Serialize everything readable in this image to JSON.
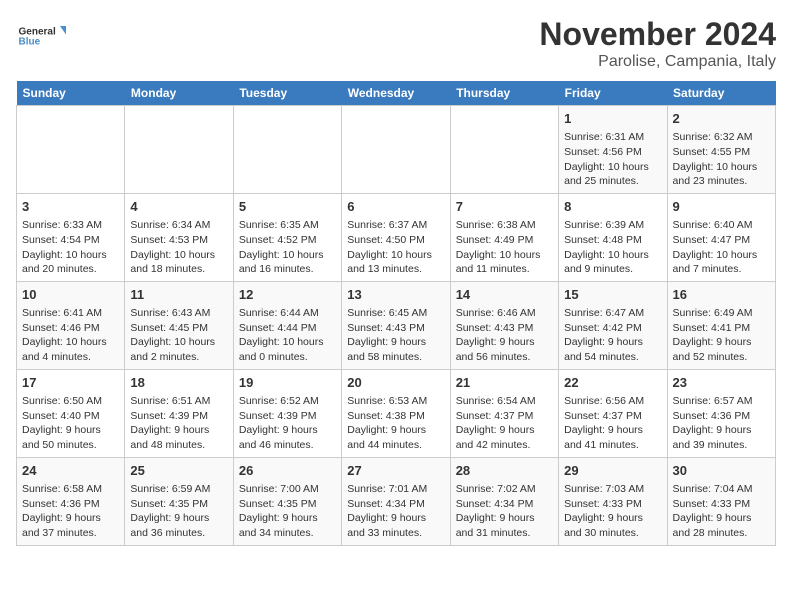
{
  "logo": {
    "line1": "General",
    "line2": "Blue"
  },
  "title": "November 2024",
  "location": "Parolise, Campania, Italy",
  "weekdays": [
    "Sunday",
    "Monday",
    "Tuesday",
    "Wednesday",
    "Thursday",
    "Friday",
    "Saturday"
  ],
  "weeks": [
    [
      {
        "day": "",
        "info": ""
      },
      {
        "day": "",
        "info": ""
      },
      {
        "day": "",
        "info": ""
      },
      {
        "day": "",
        "info": ""
      },
      {
        "day": "",
        "info": ""
      },
      {
        "day": "1",
        "info": "Sunrise: 6:31 AM\nSunset: 4:56 PM\nDaylight: 10 hours and 25 minutes."
      },
      {
        "day": "2",
        "info": "Sunrise: 6:32 AM\nSunset: 4:55 PM\nDaylight: 10 hours and 23 minutes."
      }
    ],
    [
      {
        "day": "3",
        "info": "Sunrise: 6:33 AM\nSunset: 4:54 PM\nDaylight: 10 hours and 20 minutes."
      },
      {
        "day": "4",
        "info": "Sunrise: 6:34 AM\nSunset: 4:53 PM\nDaylight: 10 hours and 18 minutes."
      },
      {
        "day": "5",
        "info": "Sunrise: 6:35 AM\nSunset: 4:52 PM\nDaylight: 10 hours and 16 minutes."
      },
      {
        "day": "6",
        "info": "Sunrise: 6:37 AM\nSunset: 4:50 PM\nDaylight: 10 hours and 13 minutes."
      },
      {
        "day": "7",
        "info": "Sunrise: 6:38 AM\nSunset: 4:49 PM\nDaylight: 10 hours and 11 minutes."
      },
      {
        "day": "8",
        "info": "Sunrise: 6:39 AM\nSunset: 4:48 PM\nDaylight: 10 hours and 9 minutes."
      },
      {
        "day": "9",
        "info": "Sunrise: 6:40 AM\nSunset: 4:47 PM\nDaylight: 10 hours and 7 minutes."
      }
    ],
    [
      {
        "day": "10",
        "info": "Sunrise: 6:41 AM\nSunset: 4:46 PM\nDaylight: 10 hours and 4 minutes."
      },
      {
        "day": "11",
        "info": "Sunrise: 6:43 AM\nSunset: 4:45 PM\nDaylight: 10 hours and 2 minutes."
      },
      {
        "day": "12",
        "info": "Sunrise: 6:44 AM\nSunset: 4:44 PM\nDaylight: 10 hours and 0 minutes."
      },
      {
        "day": "13",
        "info": "Sunrise: 6:45 AM\nSunset: 4:43 PM\nDaylight: 9 hours and 58 minutes."
      },
      {
        "day": "14",
        "info": "Sunrise: 6:46 AM\nSunset: 4:43 PM\nDaylight: 9 hours and 56 minutes."
      },
      {
        "day": "15",
        "info": "Sunrise: 6:47 AM\nSunset: 4:42 PM\nDaylight: 9 hours and 54 minutes."
      },
      {
        "day": "16",
        "info": "Sunrise: 6:49 AM\nSunset: 4:41 PM\nDaylight: 9 hours and 52 minutes."
      }
    ],
    [
      {
        "day": "17",
        "info": "Sunrise: 6:50 AM\nSunset: 4:40 PM\nDaylight: 9 hours and 50 minutes."
      },
      {
        "day": "18",
        "info": "Sunrise: 6:51 AM\nSunset: 4:39 PM\nDaylight: 9 hours and 48 minutes."
      },
      {
        "day": "19",
        "info": "Sunrise: 6:52 AM\nSunset: 4:39 PM\nDaylight: 9 hours and 46 minutes."
      },
      {
        "day": "20",
        "info": "Sunrise: 6:53 AM\nSunset: 4:38 PM\nDaylight: 9 hours and 44 minutes."
      },
      {
        "day": "21",
        "info": "Sunrise: 6:54 AM\nSunset: 4:37 PM\nDaylight: 9 hours and 42 minutes."
      },
      {
        "day": "22",
        "info": "Sunrise: 6:56 AM\nSunset: 4:37 PM\nDaylight: 9 hours and 41 minutes."
      },
      {
        "day": "23",
        "info": "Sunrise: 6:57 AM\nSunset: 4:36 PM\nDaylight: 9 hours and 39 minutes."
      }
    ],
    [
      {
        "day": "24",
        "info": "Sunrise: 6:58 AM\nSunset: 4:36 PM\nDaylight: 9 hours and 37 minutes."
      },
      {
        "day": "25",
        "info": "Sunrise: 6:59 AM\nSunset: 4:35 PM\nDaylight: 9 hours and 36 minutes."
      },
      {
        "day": "26",
        "info": "Sunrise: 7:00 AM\nSunset: 4:35 PM\nDaylight: 9 hours and 34 minutes."
      },
      {
        "day": "27",
        "info": "Sunrise: 7:01 AM\nSunset: 4:34 PM\nDaylight: 9 hours and 33 minutes."
      },
      {
        "day": "28",
        "info": "Sunrise: 7:02 AM\nSunset: 4:34 PM\nDaylight: 9 hours and 31 minutes."
      },
      {
        "day": "29",
        "info": "Sunrise: 7:03 AM\nSunset: 4:33 PM\nDaylight: 9 hours and 30 minutes."
      },
      {
        "day": "30",
        "info": "Sunrise: 7:04 AM\nSunset: 4:33 PM\nDaylight: 9 hours and 28 minutes."
      }
    ]
  ]
}
